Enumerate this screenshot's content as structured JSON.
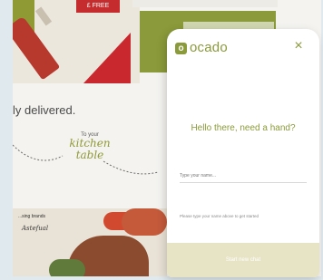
{
  "background_page": {
    "tag": "£ FREE",
    "headline": "ly delivered.",
    "to_your": "To your",
    "kitchen": "kitchen",
    "table": "table",
    "brands_label": "...sing brands",
    "brand_script": "Astefual"
  },
  "chat": {
    "logo_mark": "o",
    "logo_text": "ocado",
    "close_label": "×",
    "greeting": "Hello there, need a hand?",
    "name_placeholder": "Type your name...",
    "hint": "Please type your name above to get started",
    "start_button": "Start new chat"
  },
  "colors": {
    "brand_green": "#8b9a3a",
    "start_button_bg": "#e7e3c5"
  }
}
